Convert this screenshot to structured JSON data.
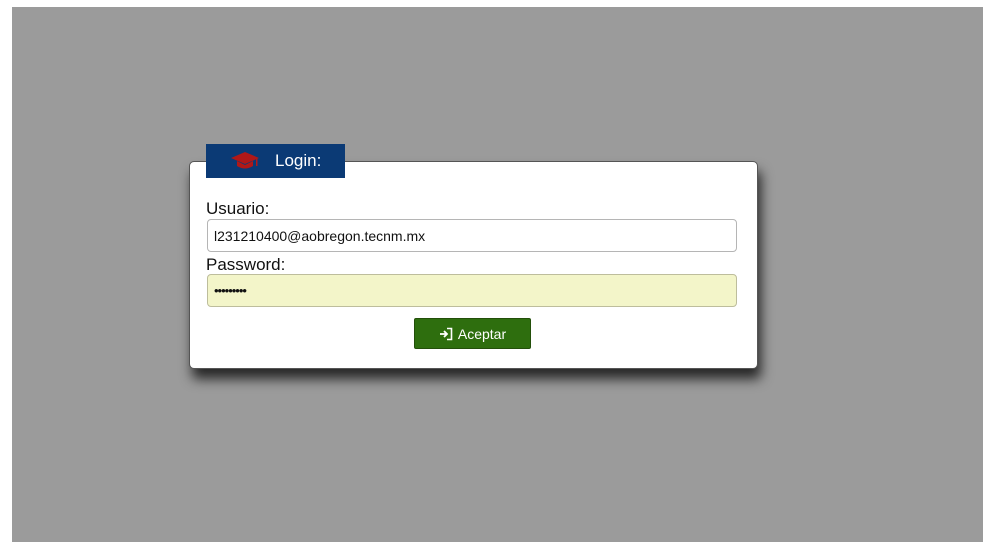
{
  "login": {
    "title": "Login:",
    "title_icon": "graduation-cap-icon",
    "username_label": "Usuario:",
    "username_value": "l231210400@aobregon.tecnm.mx",
    "password_label": "Password:",
    "password_value": "123456789",
    "submit_label": "Aceptar",
    "submit_icon": "sign-in-icon"
  },
  "colors": {
    "background": "#9b9b9b",
    "tab": "#0b3a75",
    "icon_accent": "#b01818",
    "button": "#2e6e0e",
    "password_field": "#f3f5c9"
  }
}
